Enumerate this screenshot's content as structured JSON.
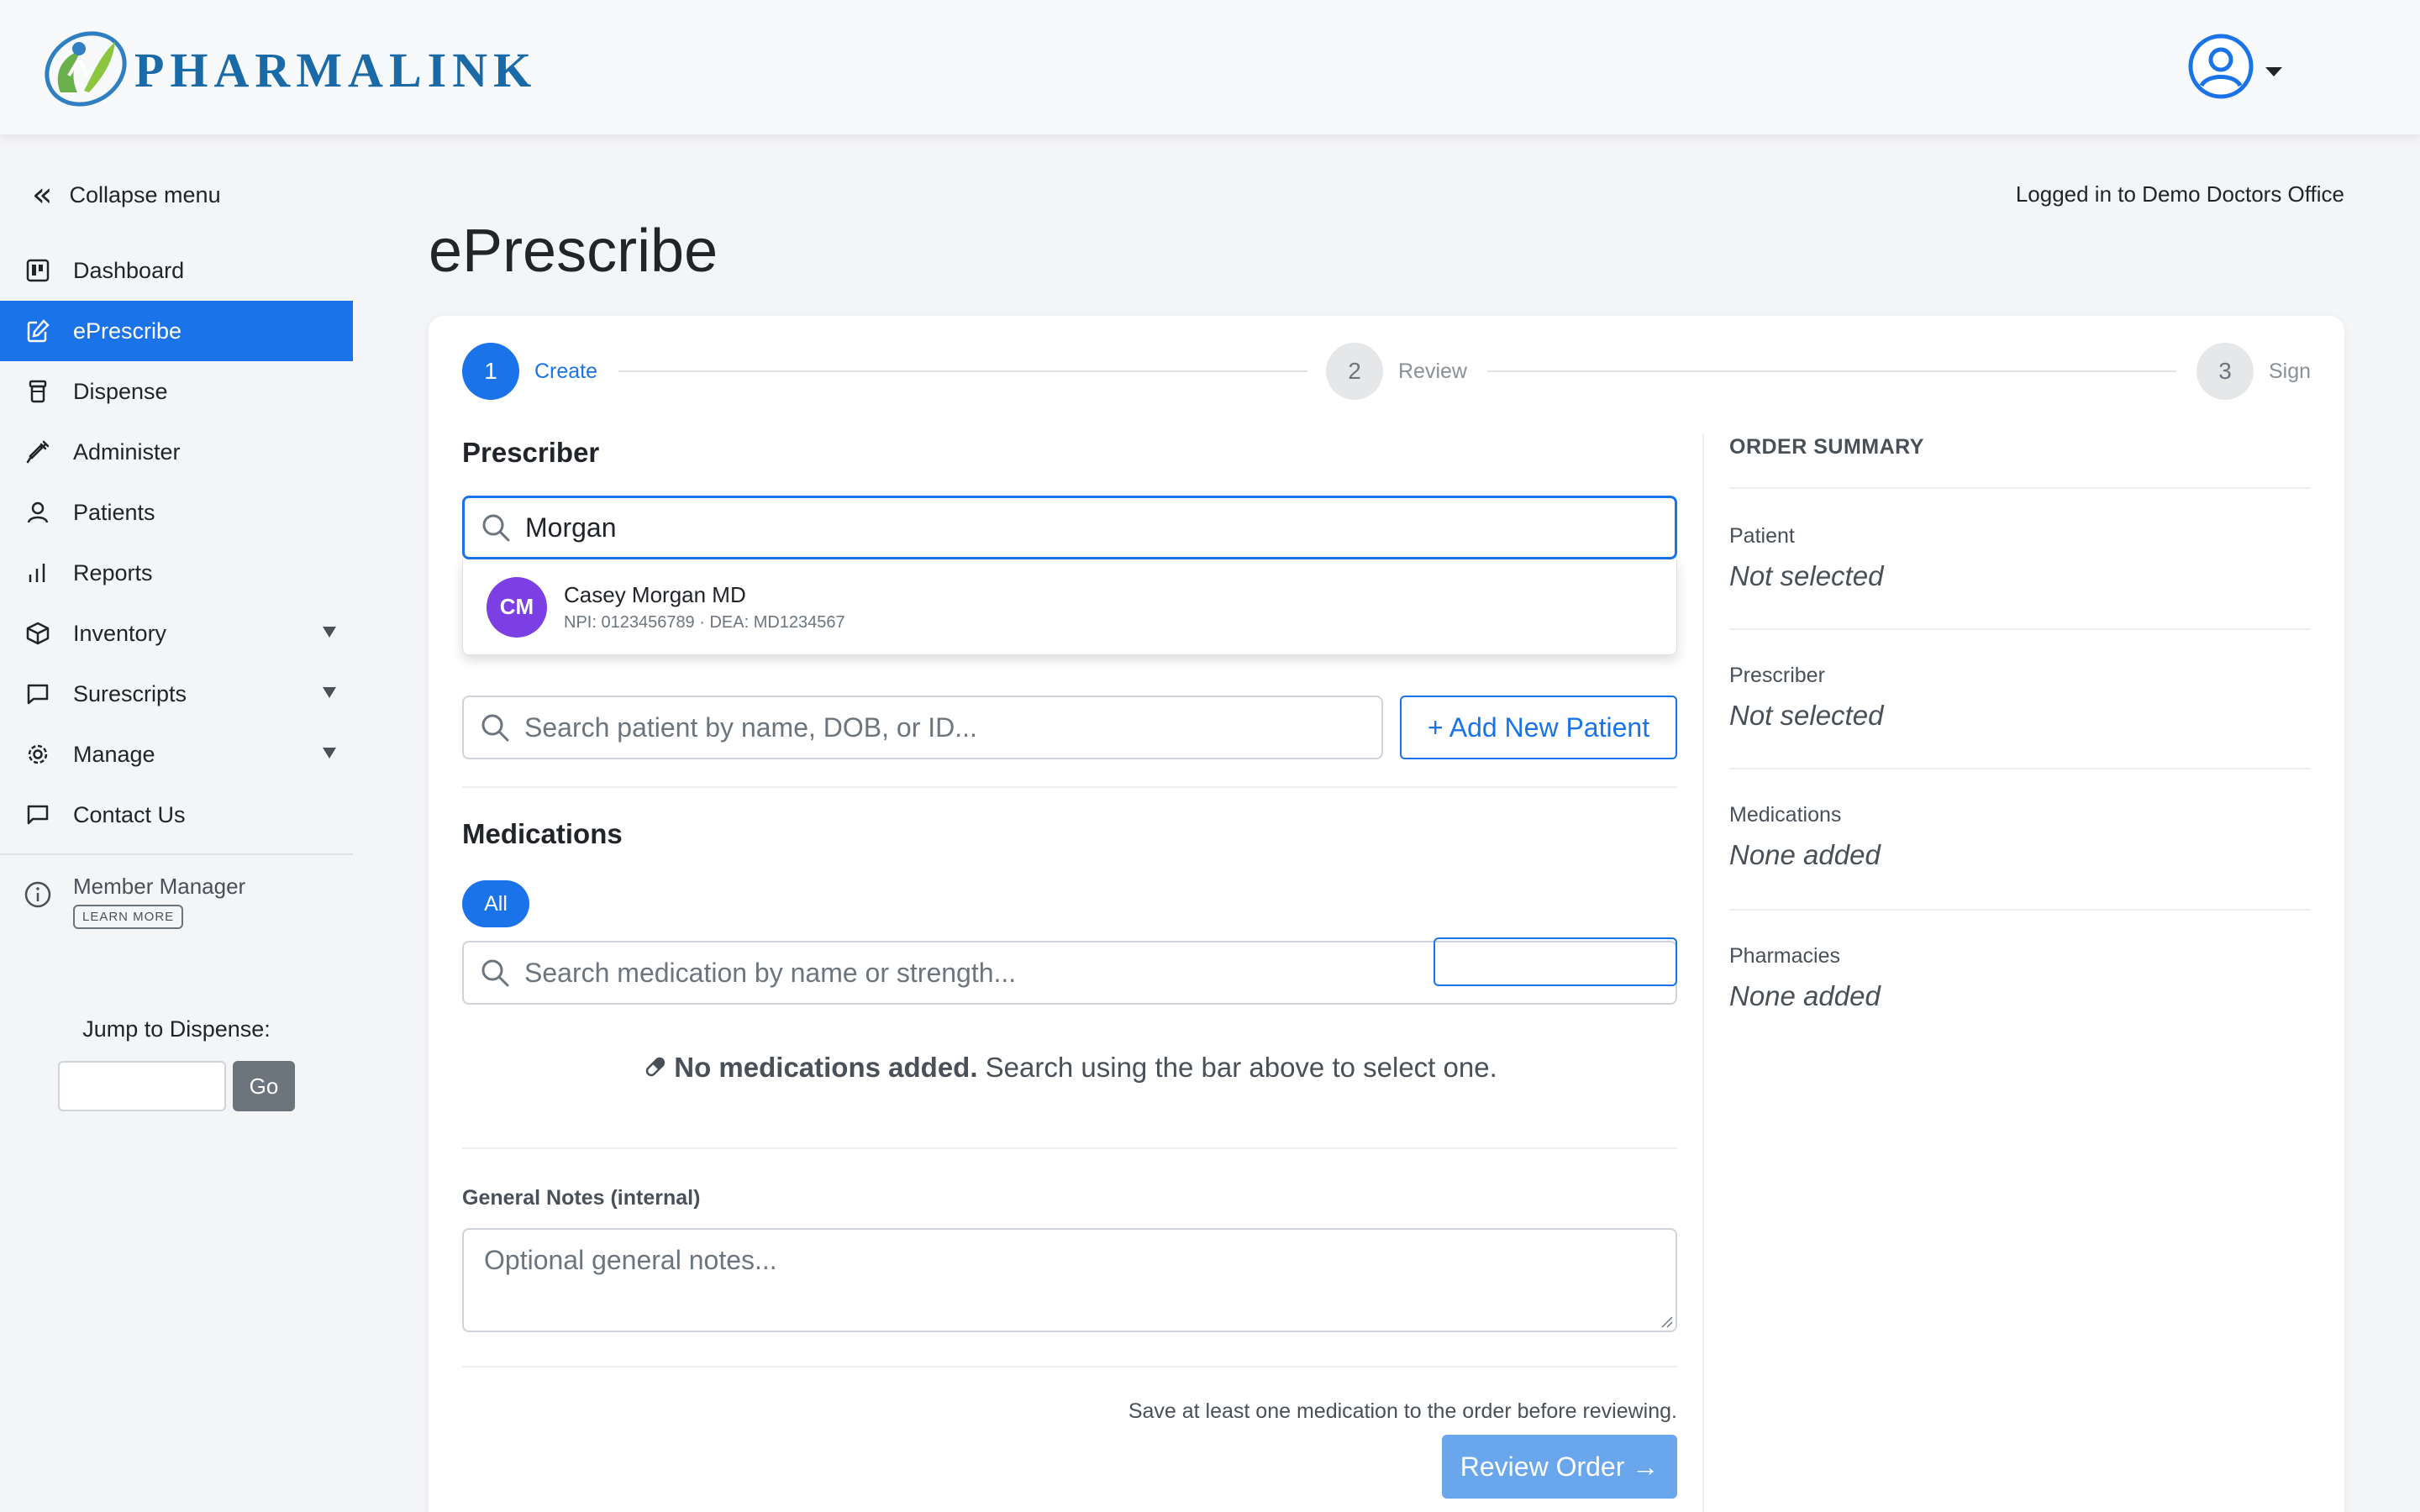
{
  "brand": {
    "name": "PHARMALINK"
  },
  "user_menu": {
    "icon": "user-circle-icon"
  },
  "sidebar": {
    "collapse_label": "Collapse menu",
    "items": [
      {
        "label": "Dashboard",
        "icon": "dashboard-icon"
      },
      {
        "label": "ePrescribe",
        "icon": "edit-icon",
        "active": true
      },
      {
        "label": "Dispense",
        "icon": "pill-bottle-icon"
      },
      {
        "label": "Administer",
        "icon": "syringe-icon"
      },
      {
        "label": "Patients",
        "icon": "person-icon"
      },
      {
        "label": "Reports",
        "icon": "bar-chart-icon"
      },
      {
        "label": "Inventory",
        "icon": "box-icon",
        "expandable": true
      },
      {
        "label": "Surescripts",
        "icon": "chat-icon",
        "expandable": true
      },
      {
        "label": "Manage",
        "icon": "gear-icon",
        "expandable": true
      },
      {
        "label": "Contact Us",
        "icon": "message-icon"
      }
    ],
    "member": {
      "title": "Member Manager",
      "button": "LEARN MORE",
      "icon": "info-icon"
    },
    "jump": {
      "label": "Jump to Dispense:",
      "input_value": "",
      "go_label": "Go"
    }
  },
  "header": {
    "logged_in": "Logged in to Demo Doctors Office"
  },
  "page": {
    "title": "ePrescribe"
  },
  "stepper": [
    {
      "num": "1",
      "label": "Create",
      "state": "active"
    },
    {
      "num": "2",
      "label": "Review",
      "state": "inactive"
    },
    {
      "num": "3",
      "label": "Sign",
      "state": "inactive"
    }
  ],
  "prescriber": {
    "title": "Prescriber",
    "search_value": "Morgan",
    "result": {
      "initials": "CM",
      "name": "Casey Morgan MD",
      "sub": "NPI: 0123456789 · DEA: MD1234567"
    }
  },
  "patient": {
    "placeholder": "Search patient by name, DOB, or ID...",
    "add_label": "+ Add New Patient"
  },
  "medications": {
    "title": "Medications",
    "filter_all": "All",
    "placeholder": "Search medication by name or strength...",
    "empty_bold": "No medications added.",
    "empty_rest": " Search using the bar above to select one.",
    "empty_icon": "pill-icon"
  },
  "notes": {
    "label": "General Notes (internal)",
    "placeholder": "Optional general notes..."
  },
  "footer": {
    "helper": "Save at least one medication to the order before reviewing.",
    "review_label": "Review Order →"
  },
  "summary": {
    "title": "ORDER SUMMARY",
    "items": [
      {
        "label": "Patient",
        "value": "Not selected"
      },
      {
        "label": "Prescriber",
        "value": "Not selected"
      },
      {
        "label": "Medications",
        "value": "None added"
      },
      {
        "label": "Pharmacies",
        "value": "None added"
      }
    ]
  },
  "colors": {
    "primary": "#1a73e8",
    "avatar": "#7b3fe4",
    "brand": "#1a6aa8"
  }
}
